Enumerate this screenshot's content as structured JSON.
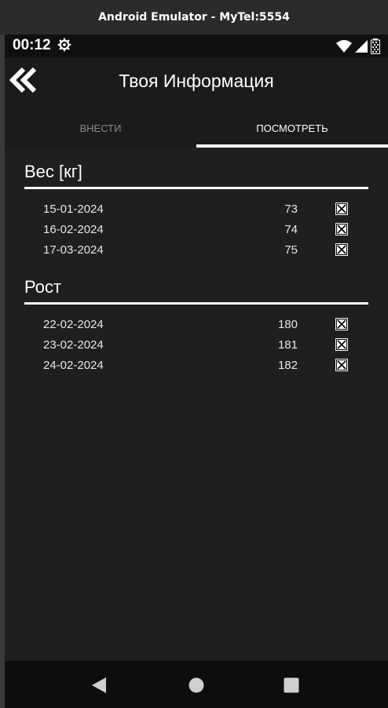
{
  "window": {
    "title": "Android Emulator - MyTel:5554"
  },
  "status_bar": {
    "time": "00:12"
  },
  "app_bar": {
    "title": "Твоя Информация"
  },
  "tabs": [
    {
      "label": "ВНЕСТИ",
      "selected": false
    },
    {
      "label": "ПОСМОТРЕТЬ",
      "selected": true
    }
  ],
  "sections": [
    {
      "title": "Вес [кг]",
      "rows": [
        {
          "date": "15-01-2024",
          "value": "73"
        },
        {
          "date": "16-02-2024",
          "value": "74"
        },
        {
          "date": "17-03-2024",
          "value": "75"
        }
      ]
    },
    {
      "title": "Рост",
      "rows": [
        {
          "date": "22-02-2024",
          "value": "180"
        },
        {
          "date": "23-02-2024",
          "value": "181"
        },
        {
          "date": "24-02-2024",
          "value": "182"
        }
      ]
    }
  ],
  "colors": {
    "background": "#1f1f1f",
    "text": "#ffffff",
    "muted_tab": "#8a8a8a"
  }
}
